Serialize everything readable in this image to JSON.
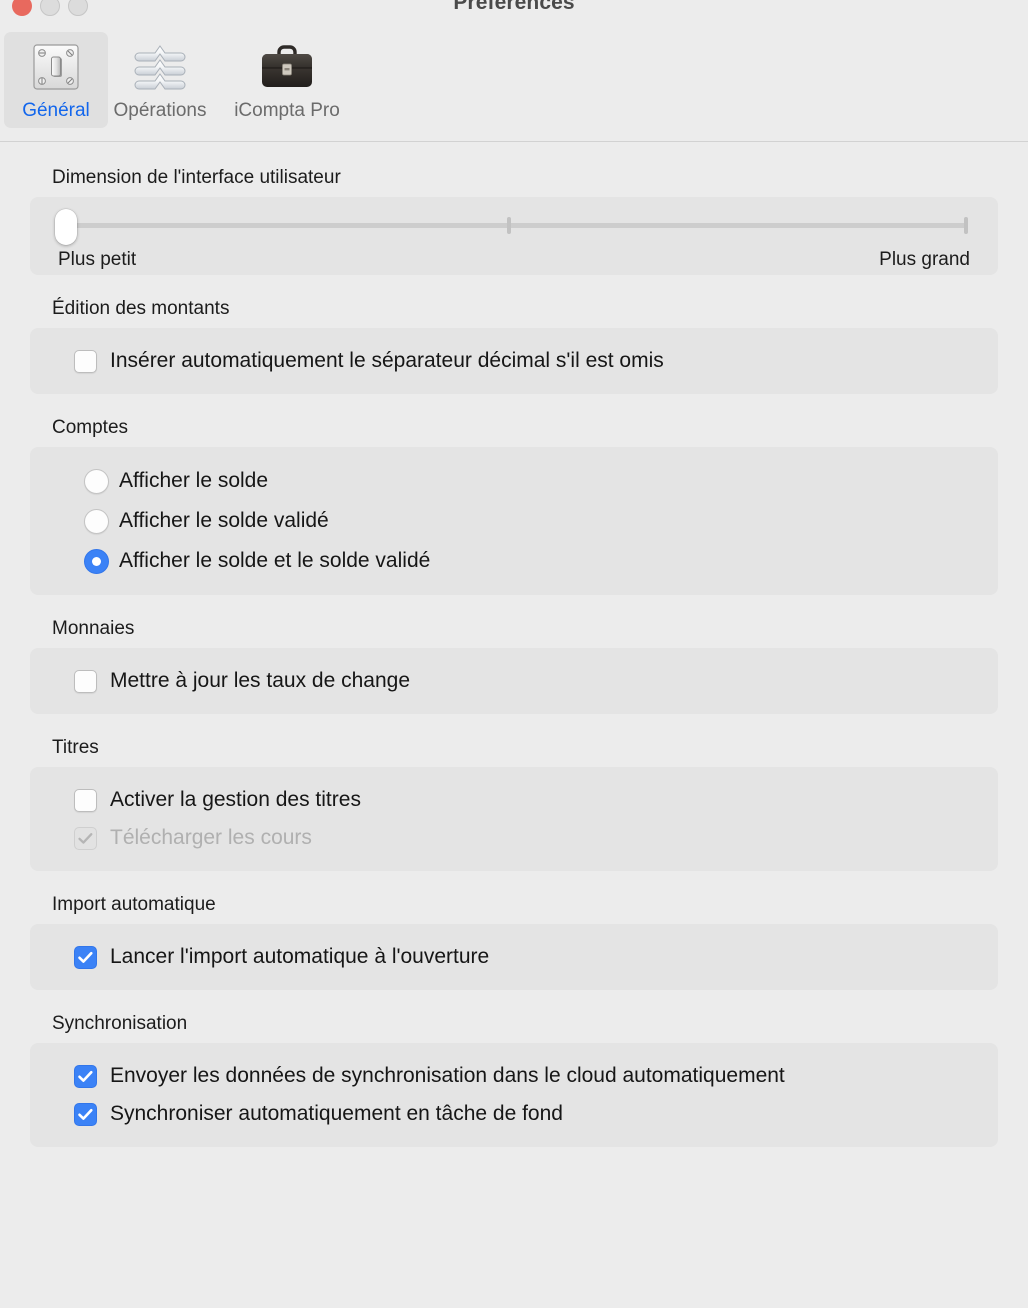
{
  "window": {
    "title": "Préférences",
    "traffic_lights": [
      {
        "name": "close-button",
        "color": "#e8695e"
      },
      {
        "name": "minimize-button",
        "color": "#dcdcdc"
      },
      {
        "name": "maximize-button",
        "color": "#dcdcdc"
      }
    ]
  },
  "toolbar": {
    "tabs": [
      {
        "label": "Général",
        "icon": "light-switch-icon",
        "selected": true
      },
      {
        "label": "Opérations",
        "icon": "sliders-icon",
        "selected": false
      },
      {
        "label": "iCompta Pro",
        "icon": "briefcase-icon",
        "selected": false
      }
    ]
  },
  "sections": {
    "interface_size": {
      "label": "Dimension de l'interface utilisateur",
      "slider": {
        "value": 0,
        "min_label": "Plus petit",
        "max_label": "Plus grand",
        "ticks": 3
      }
    },
    "amount_editing": {
      "label": "Édition des montants",
      "options": [
        {
          "label": "Insérer automatiquement le séparateur décimal s'il est omis",
          "checked": false,
          "enabled": true
        }
      ]
    },
    "accounts": {
      "label": "Comptes",
      "options": [
        {
          "label": "Afficher le solde",
          "selected": false
        },
        {
          "label": "Afficher le solde validé",
          "selected": false
        },
        {
          "label": "Afficher le solde et le solde validé",
          "selected": true
        }
      ]
    },
    "currencies": {
      "label": "Monnaies",
      "options": [
        {
          "label": "Mettre à jour les taux de change",
          "checked": false,
          "enabled": true
        }
      ]
    },
    "securities": {
      "label": "Titres",
      "options": [
        {
          "label": "Activer la gestion des titres",
          "checked": false,
          "enabled": true
        },
        {
          "label": "Télécharger les cours",
          "checked": true,
          "enabled": false
        }
      ]
    },
    "auto_import": {
      "label": "Import automatique",
      "options": [
        {
          "label": "Lancer l'import automatique à l'ouverture",
          "checked": true,
          "enabled": true
        }
      ]
    },
    "synchronization": {
      "label": "Synchronisation",
      "options": [
        {
          "label": "Envoyer les données de synchronisation dans le cloud automatiquement",
          "checked": true,
          "enabled": true
        },
        {
          "label": "Synchroniser automatiquement en tâche de fond",
          "checked": true,
          "enabled": true
        }
      ]
    }
  },
  "colors": {
    "accent_blue": "#3b82f6",
    "selected_tab_text": "#1266ec",
    "window_bg": "#ececec",
    "group_bg": "#e4e4e4",
    "close_red": "#e8695e"
  }
}
